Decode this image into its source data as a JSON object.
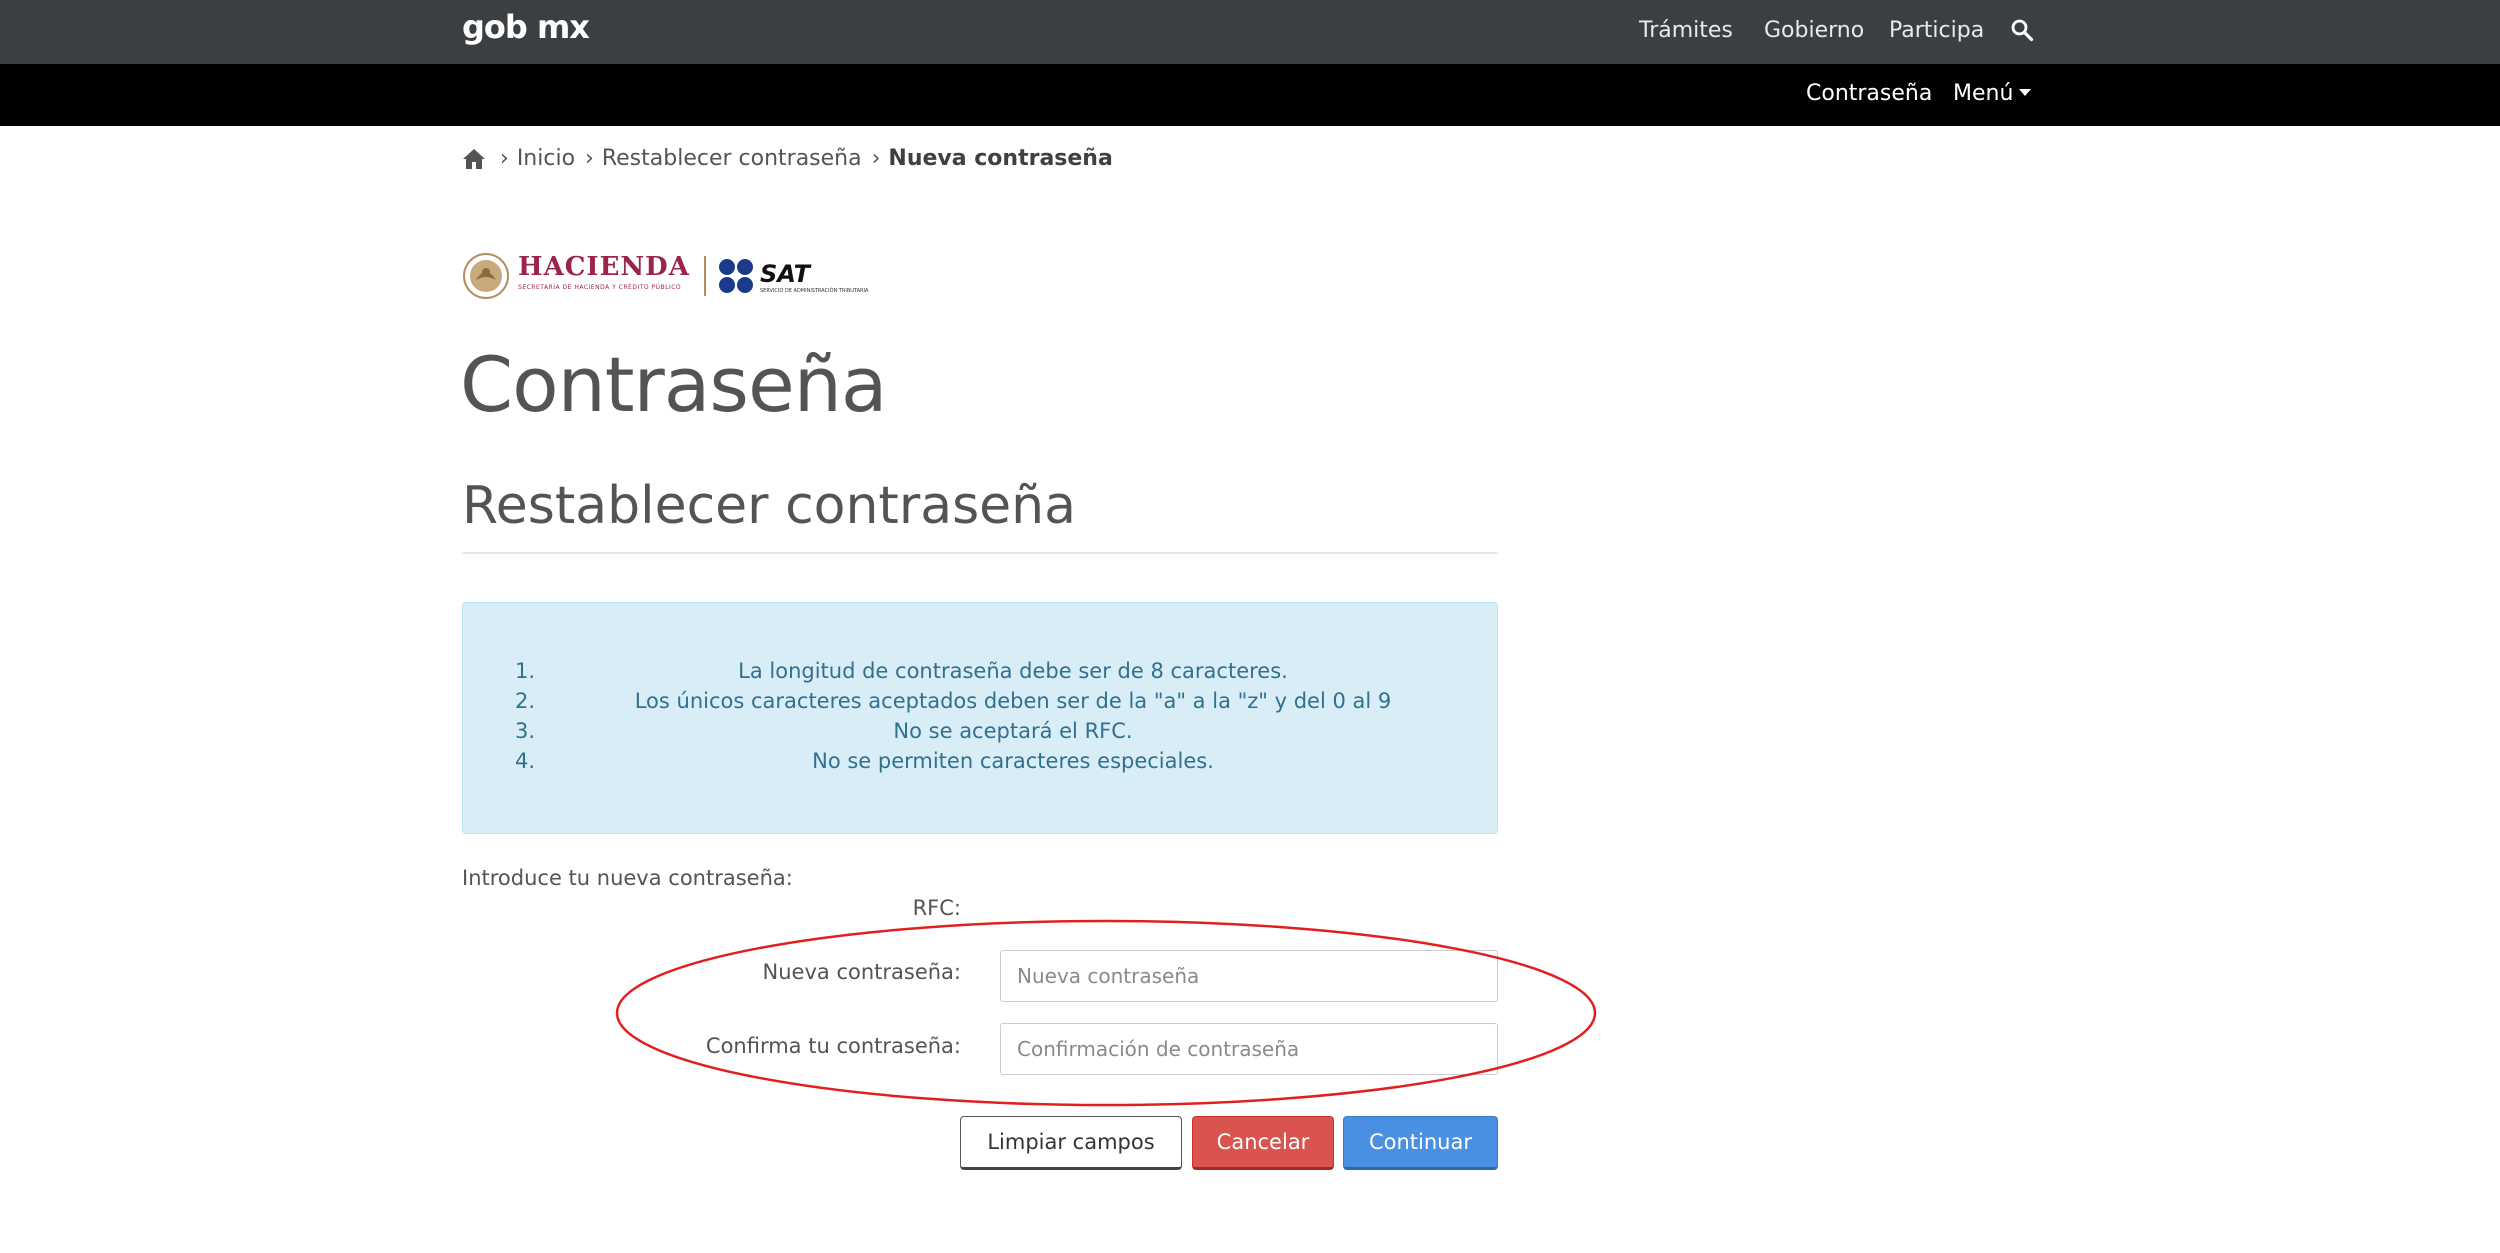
{
  "topbar": {
    "logo": "gob mx",
    "nav": [
      "Trámites",
      "Gobierno",
      "Participa"
    ]
  },
  "subbar": {
    "password_link": "Contraseña",
    "menu_label": "Menú"
  },
  "breadcrumb": {
    "items": [
      "Inicio",
      "Restablecer contraseña",
      "Nueva contraseña"
    ]
  },
  "logos": {
    "hacienda": "HACIENDA",
    "hacienda_sub": "SECRETARÍA DE HACIENDA Y CRÉDITO PÚBLICO",
    "sat": "SAT",
    "sat_sub": "SERVICIO DE ADMINISTRACIÓN TRIBUTARIA"
  },
  "page": {
    "title": "Contraseña",
    "section_title": "Restablecer contraseña"
  },
  "rules": [
    {
      "num": "1.",
      "text": "La longitud de contraseña debe ser de 8 caracteres."
    },
    {
      "num": "2.",
      "text": "Los únicos caracteres aceptados deben ser de la \"a\" a la \"z\" y del 0 al 9"
    },
    {
      "num": "3.",
      "text": "No se aceptará el RFC."
    },
    {
      "num": "4.",
      "text": "No se permiten caracteres especiales."
    }
  ],
  "form": {
    "intro": "Introduce tu nueva contraseña:",
    "rfc_label": "RFC:",
    "new_password_label": "Nueva contraseña:",
    "new_password_placeholder": "Nueva contraseña",
    "confirm_label": "Confirma tu contraseña:",
    "confirm_placeholder": "Confirmación de contraseña"
  },
  "buttons": {
    "clear": "Limpiar campos",
    "cancel": "Cancelar",
    "continue": "Continuar"
  },
  "colors": {
    "topbar": "#3b3f42",
    "subbar": "#000000",
    "alert_bg": "#d9edf7",
    "alert_text": "#31708f",
    "danger": "#d9534f",
    "primary": "#4a90e2",
    "annotation": "#e0201e"
  }
}
